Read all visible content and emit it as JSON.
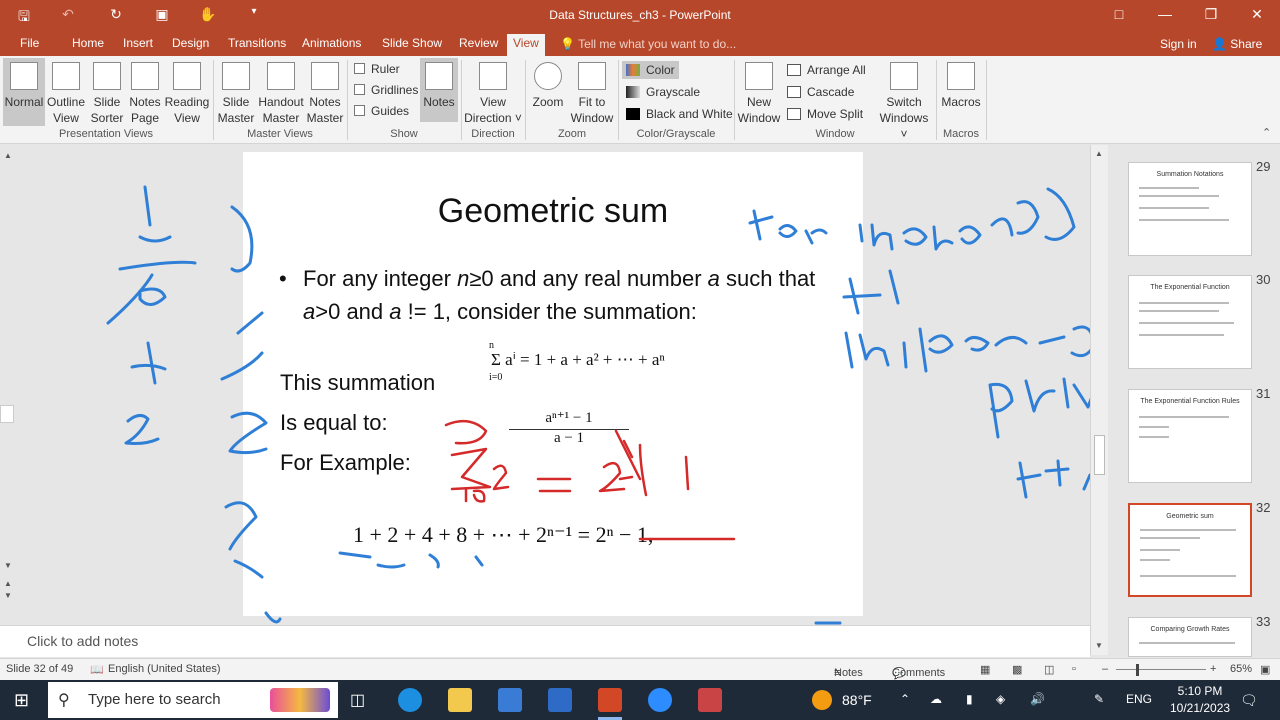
{
  "app": {
    "doc_title": "Data Structures_ch3 - PowerPoint"
  },
  "tabs": [
    {
      "label": "File"
    },
    {
      "label": "Home"
    },
    {
      "label": "Insert"
    },
    {
      "label": "Design"
    },
    {
      "label": "Transitions"
    },
    {
      "label": "Animations"
    },
    {
      "label": "Slide Show"
    },
    {
      "label": "Review"
    },
    {
      "label": "View"
    }
  ],
  "tell_me": "Tell me what you want to do...",
  "sign_in": "Sign in",
  "share": "Share",
  "ribbon": {
    "presentation_views": {
      "group": "Presentation Views",
      "normal": "Normal",
      "outline_1": "Outline",
      "outline_2": "View",
      "sorter_1": "Slide",
      "sorter_2": "Sorter",
      "notes_page_1": "Notes",
      "notes_page_2": "Page",
      "reading_1": "Reading",
      "reading_2": "View"
    },
    "master_views": {
      "group": "Master Views",
      "slide_1": "Slide",
      "slide_2": "Master",
      "handout_1": "Handout",
      "handout_2": "Master",
      "notes_1": "Notes",
      "notes_2": "Master"
    },
    "show": {
      "group": "Show",
      "ruler": "Ruler",
      "gridlines": "Gridlines",
      "guides": "Guides",
      "notes": "Notes"
    },
    "direction": {
      "group": "Direction",
      "view_1": "View",
      "view_2": "Direction ˅"
    },
    "zoom": {
      "group": "Zoom",
      "zoom": "Zoom",
      "fit_1": "Fit to",
      "fit_2": "Window"
    },
    "color": {
      "group": "Color/Grayscale",
      "color": "Color",
      "grayscale": "Grayscale",
      "bw": "Black and White"
    },
    "window": {
      "group": "Window",
      "new_1": "New",
      "new_2": "Window",
      "arrange": "Arrange All",
      "cascade": "Cascade",
      "move_split": "Move Split",
      "switch_1": "Switch",
      "switch_2": "Windows ˅"
    },
    "macros": {
      "group": "Macros",
      "macros": "Macros"
    }
  },
  "slide": {
    "title": "Geometric sum",
    "bullet_parts": [
      "For any integer ",
      "n",
      "≥0 and any real number ",
      "a",
      " such that ",
      "a",
      ">0 and ",
      "a",
      " != 1, consider the summation:"
    ],
    "line1": "This summation",
    "line2": "Is equal to:",
    "line3": "For Example:",
    "sum_formula": "Σ aⁱ = 1 + a + a² + ⋯ + aⁿ",
    "sum_limits": {
      "upper": "n",
      "lower": "i=0"
    },
    "fraction": {
      "num": "aⁿ⁺¹ − 1",
      "den": "a − 1"
    },
    "example": "1 + 2 + 4 + 8 + ⋯ + 2ⁿ⁻¹ = 2ⁿ − 1,"
  },
  "notes_placeholder": "Click to add notes",
  "thumbnails": [
    {
      "num": "29",
      "title": "Summation Notations"
    },
    {
      "num": "30",
      "title": "The Exponential Function"
    },
    {
      "num": "31",
      "title": "The Exponential Function Rules"
    },
    {
      "num": "32",
      "title": "Geometric sum"
    },
    {
      "num": "33",
      "title": "Comparing Growth Rates"
    }
  ],
  "status": {
    "slide_info": "Slide 32 of 49",
    "language": "English (United States)",
    "notes": "Notes",
    "comments": "Comments",
    "zoom": "65%"
  },
  "taskbar": {
    "search_placeholder": "Type here to search",
    "weather": "88°F",
    "lang": "ENG",
    "time": "5:10 PM",
    "date": "10/21/2023"
  },
  "colors": {
    "accent": "#b7472a",
    "ink_blue": "#2f7fd6",
    "ink_red": "#d42a2a"
  }
}
